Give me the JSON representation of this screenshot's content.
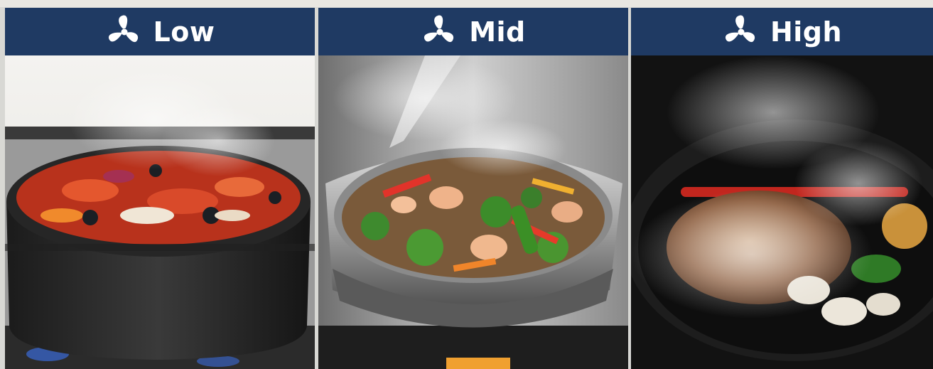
{
  "panels": [
    {
      "label": "Low",
      "icon": "fan-icon"
    },
    {
      "label": "Mid",
      "icon": "fan-icon"
    },
    {
      "label": "High",
      "icon": "fan-icon"
    }
  ],
  "colors": {
    "header": "#1f3a63",
    "label": "#ffffff"
  }
}
